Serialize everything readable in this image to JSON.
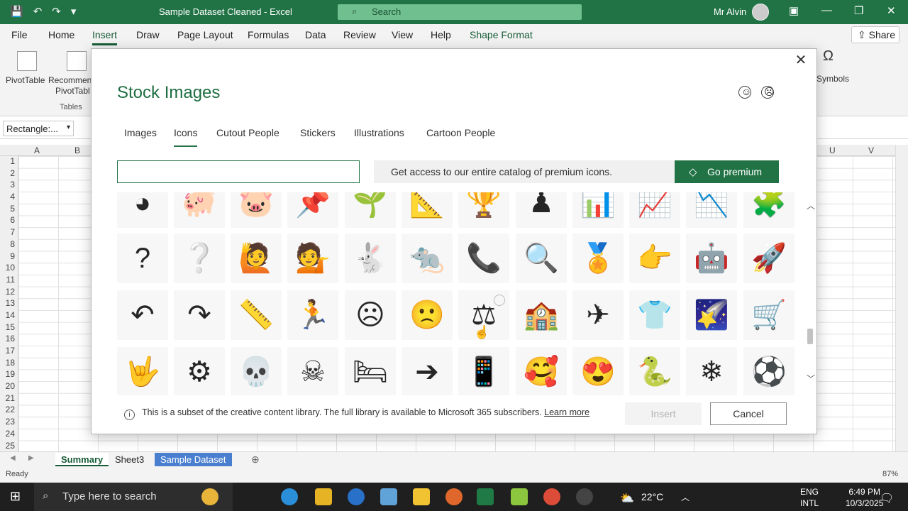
{
  "titlebar": {
    "doc_title": "Sample Dataset Cleaned  -  Excel",
    "search_placeholder": "Search",
    "user_name": "Mr Alvin"
  },
  "ribbon_tabs": [
    "File",
    "Home",
    "Insert",
    "Draw",
    "Page Layout",
    "Formulas",
    "Data",
    "Review",
    "View",
    "Help",
    "Shape Format"
  ],
  "ribbon": {
    "share": "Share",
    "pivot_table": "PivotTable",
    "recommended_1": "Recommen",
    "recommended_2": "PivotTabl",
    "tables_group": "Tables",
    "symbols": "Symbols"
  },
  "namebox": "Rectangle:...",
  "columns": [
    "A",
    "B",
    "U",
    "V"
  ],
  "rows": [
    "1",
    "2",
    "3",
    "4",
    "5",
    "6",
    "7",
    "8",
    "9",
    "10",
    "11",
    "12",
    "13",
    "14",
    "15",
    "16",
    "17",
    "18",
    "19",
    "20",
    "21",
    "22",
    "23",
    "24",
    "25"
  ],
  "sheets": {
    "summary": "Summary",
    "sheet3": "Sheet3",
    "sample": "Sample Dataset"
  },
  "status": {
    "ready": "Ready",
    "zoom": "87%"
  },
  "taskbar": {
    "search": "Type here to search",
    "weather": "22°C",
    "lang1": "ENG",
    "lang2": "INTL",
    "time": "6:49 PM",
    "date": "10/3/2025"
  },
  "dialog": {
    "title": "Stock Images",
    "tabs": [
      "Images",
      "Icons",
      "Cutout People",
      "Stickers",
      "Illustrations",
      "Cartoon People"
    ],
    "active_tab": "Icons",
    "search_value": "",
    "premium_text": "Get access to our entire catalog of premium icons.",
    "premium_button": "Go premium",
    "footer_text": "This is a subset of the creative content library. The full library is available to Microsoft 365 subscribers.",
    "footer_link": "Learn more",
    "insert_button": "Insert",
    "cancel_button": "Cancel",
    "icon_rows": [
      [
        {
          "name": "pie-chart-icon",
          "glyph": "◕"
        },
        {
          "name": "pig-icon",
          "glyph": "🐖"
        },
        {
          "name": "piggy-bank-icon",
          "glyph": "🐷"
        },
        {
          "name": "pin-icon",
          "glyph": "📌"
        },
        {
          "name": "plant-icon",
          "glyph": "🌱"
        },
        {
          "name": "math-board-icon",
          "glyph": "📐"
        },
        {
          "name": "podium-icon",
          "glyph": "🏆"
        },
        {
          "name": "chess-piece-icon",
          "glyph": "♟"
        },
        {
          "name": "presentation-chart-icon",
          "glyph": "📊"
        },
        {
          "name": "presentation-bars-icon",
          "glyph": "📈"
        },
        {
          "name": "presentation-pie-icon",
          "glyph": "📉"
        },
        {
          "name": "puzzle-icon",
          "glyph": "🧩"
        }
      ],
      [
        {
          "name": "question-mark-icon",
          "glyph": "?"
        },
        {
          "name": "question-mark-outline-icon",
          "glyph": "❔"
        },
        {
          "name": "person-question-icon",
          "glyph": "🙋"
        },
        {
          "name": "person-question-2-icon",
          "glyph": "💁"
        },
        {
          "name": "rabbit-icon",
          "glyph": "🐇"
        },
        {
          "name": "rat-icon",
          "glyph": "🐀"
        },
        {
          "name": "phone-receiver-icon",
          "glyph": "📞"
        },
        {
          "name": "research-icon",
          "glyph": "🔍"
        },
        {
          "name": "ribbon-award-icon",
          "glyph": "🏅"
        },
        {
          "name": "pointing-hand-icon",
          "glyph": "👉"
        },
        {
          "name": "robot-icon",
          "glyph": "🤖"
        },
        {
          "name": "rocket-icon",
          "glyph": "🚀"
        }
      ],
      [
        {
          "name": "rotate-left-icon",
          "glyph": "↶"
        },
        {
          "name": "rotate-right-icon",
          "glyph": "↷"
        },
        {
          "name": "ruler-icon",
          "glyph": "📏"
        },
        {
          "name": "running-person-icon",
          "glyph": "🏃"
        },
        {
          "name": "sad-face-icon",
          "glyph": "☹"
        },
        {
          "name": "sad-face-outline-icon",
          "glyph": "🙁"
        },
        {
          "name": "scales-justice-icon",
          "glyph": "⚖"
        },
        {
          "name": "school-building-icon",
          "glyph": "🏫"
        },
        {
          "name": "paper-plane-icon",
          "glyph": "✈"
        },
        {
          "name": "t-shirt-icon",
          "glyph": "👕"
        },
        {
          "name": "shooting-star-icon",
          "glyph": "🌠"
        },
        {
          "name": "shopping-cart-icon",
          "glyph": "🛒"
        }
      ],
      [
        {
          "name": "sign-language-icon",
          "glyph": "🤟"
        },
        {
          "name": "gear-icon",
          "glyph": "⚙"
        },
        {
          "name": "skeleton-icon",
          "glyph": "💀"
        },
        {
          "name": "skull-icon",
          "glyph": "☠"
        },
        {
          "name": "bed-icon",
          "glyph": "🛏"
        },
        {
          "name": "arrow-right-icon",
          "glyph": "➔"
        },
        {
          "name": "smartphone-icon",
          "glyph": "📱"
        },
        {
          "name": "smiley-hearts-icon",
          "glyph": "🥰"
        },
        {
          "name": "smiley-hearts-outline-icon",
          "glyph": "😍"
        },
        {
          "name": "snake-icon",
          "glyph": "🐍"
        },
        {
          "name": "snowflake-icon",
          "glyph": "❄"
        },
        {
          "name": "soccer-ball-icon",
          "glyph": "⚽"
        }
      ]
    ]
  }
}
